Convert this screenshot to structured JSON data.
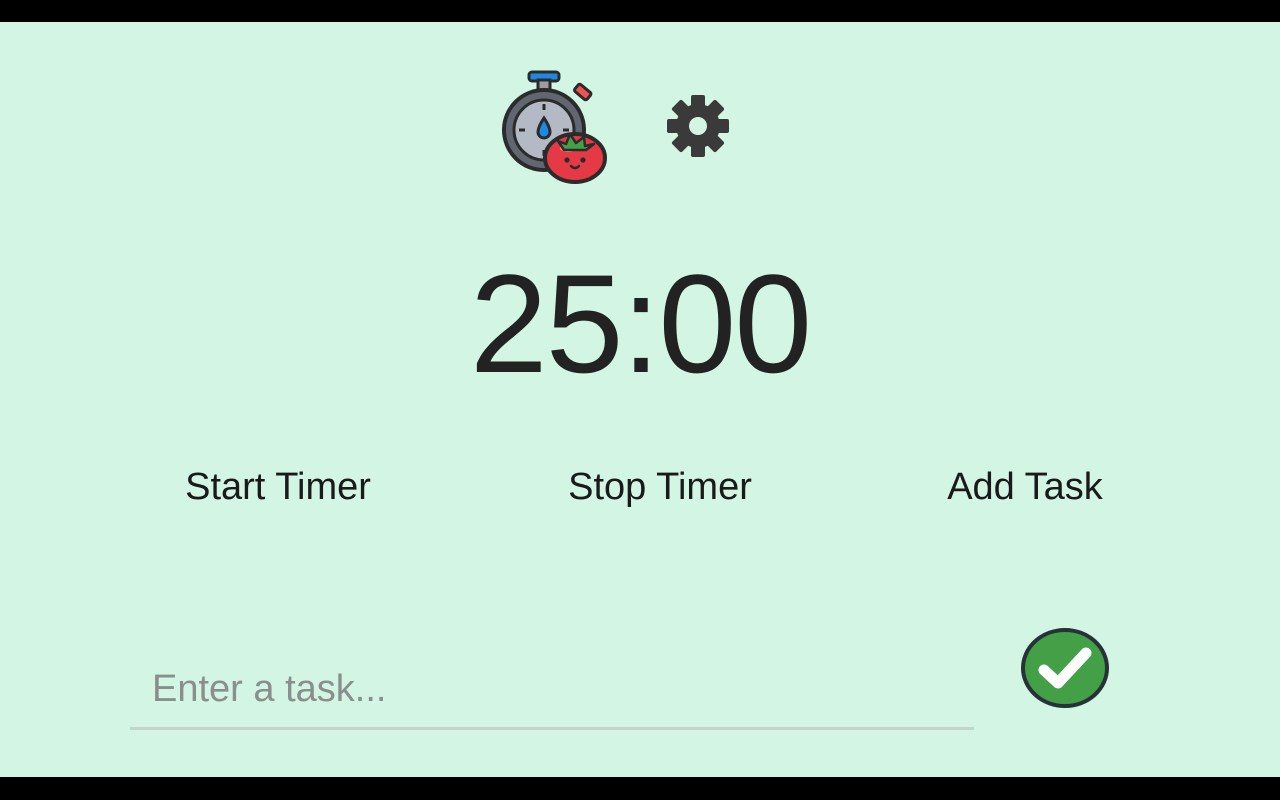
{
  "colors": {
    "background": "#d3f5e4",
    "text": "#222222",
    "accent_green": "#43a047",
    "tomato_red": "#e53945"
  },
  "header": {
    "logo_icon": "stopwatch-tomato-icon",
    "settings_icon": "gear-icon"
  },
  "timer": {
    "display": "25:00"
  },
  "controls": {
    "start_label": "Start Timer",
    "stop_label": "Stop Timer",
    "add_label": "Add Task"
  },
  "task_entry": {
    "value": "",
    "placeholder": "Enter a task...",
    "submit_icon": "checkmark-icon"
  }
}
